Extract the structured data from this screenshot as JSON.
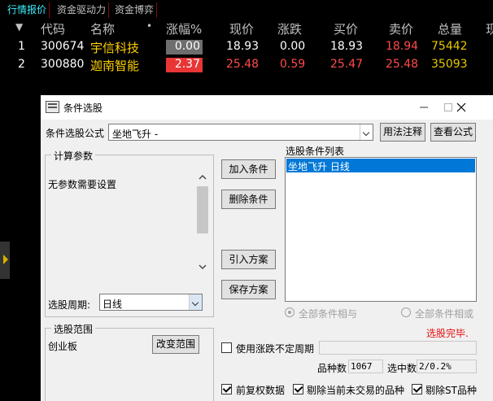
{
  "tabs": [
    "行情报价",
    "资金驱动力",
    "资金博弈"
  ],
  "table": {
    "sort_marker": "▼",
    "dot": "•",
    "headers": [
      "代码",
      "名称",
      "涨幅%",
      "现价",
      "涨跌",
      "买价",
      "卖价",
      "总量",
      "现"
    ],
    "rows": [
      {
        "idx": "1",
        "code": "300674",
        "name": "宇信科技",
        "chg_pct": "0.00",
        "price": "18.93",
        "chg": "0.00",
        "bid": "18.93",
        "ask": "18.94",
        "vol": "75442"
      },
      {
        "idx": "2",
        "code": "300880",
        "name": "迦南智能",
        "chg_pct": "2.37",
        "price": "25.48",
        "chg": "0.59",
        "bid": "25.47",
        "ask": "25.48",
        "vol": "35093"
      }
    ]
  },
  "dialog": {
    "title": "条件选股",
    "formula_label": "条件选股公式",
    "formula_value": "坐地飞升      -",
    "usage_btn": "用法注释",
    "view_formula_btn": "查看公式",
    "params_group": "计算参数",
    "params_text": "无参数需要设置",
    "period_label": "选股周期:",
    "period_value": "日线",
    "add_btn": "加入条件",
    "del_btn": "删除条件",
    "import_btn": "引入方案",
    "save_btn": "保存方案",
    "list_label": "选股条件列表",
    "list_items": [
      "坐地飞升  日线"
    ],
    "radio_and": "全部条件相与",
    "radio_or": "全部条件相或",
    "status": "选股完毕.",
    "range_group": "选股范围",
    "range_value": "创业板",
    "change_range_btn": "改变范围",
    "use_period_label": "使用涨跌不定周期",
    "count_label": "品种数",
    "count_value": "1067",
    "selected_label": "选中数",
    "selected_value": "2/0.2%",
    "chk_fq": "前复权数据",
    "chk_exclude_untraded": "剔除当前未交易的品种",
    "chk_exclude_st": "剔除ST品种"
  },
  "colors": {
    "accent_red": "#e83535",
    "cyan_tab": "#3cf0ff",
    "code_yellow": "#ffd200",
    "selection_blue": "#0078d7"
  },
  "icons": [
    "minimize-icon",
    "maximize-icon",
    "close-icon",
    "dropdown-arrow-icon",
    "scroll-up-icon",
    "scroll-down-icon",
    "side-expand-icon"
  ]
}
